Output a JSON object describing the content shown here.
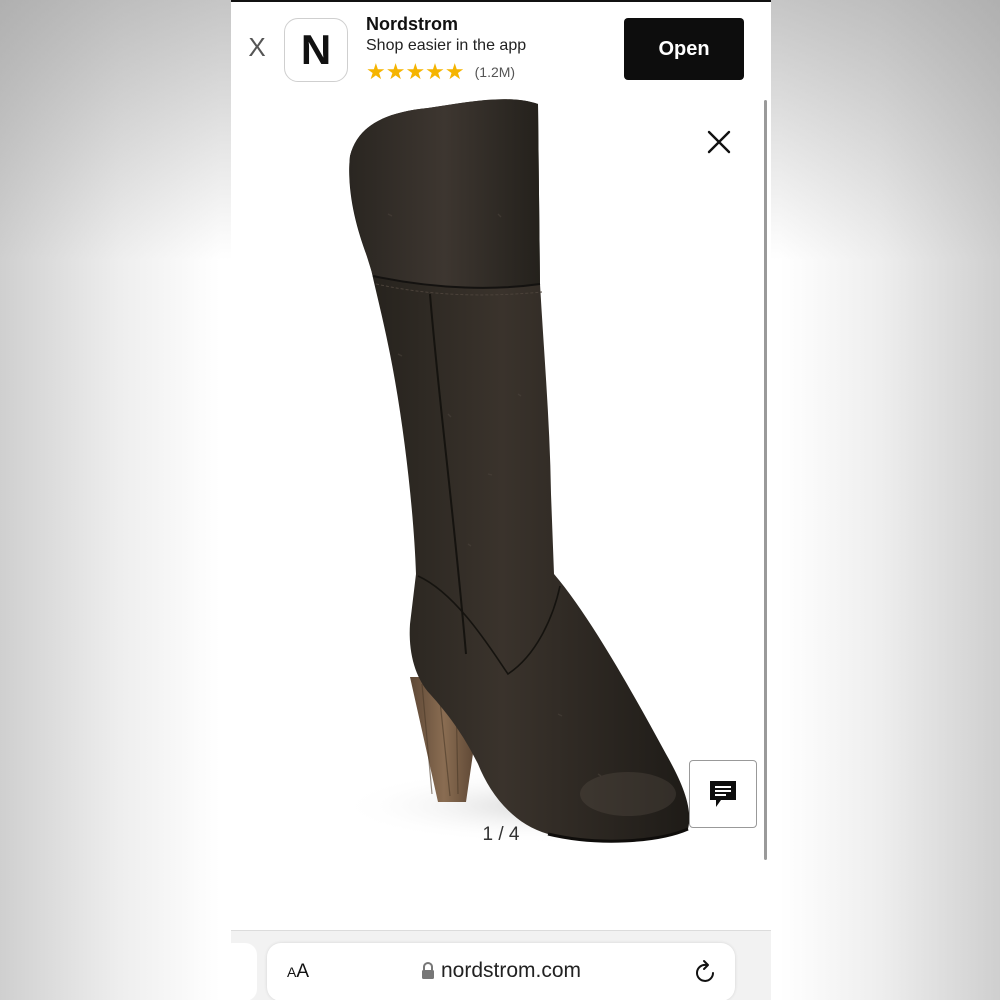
{
  "banner": {
    "close_label": "X",
    "icon_letter": "N",
    "app_name": "Nordstrom",
    "tagline": "Shop easier in the app",
    "stars": "★★★★★",
    "rating_count": "(1.2M)",
    "open_label": "Open"
  },
  "viewer": {
    "counter": "1 / 4",
    "image_index": 1,
    "image_total": 4
  },
  "browser": {
    "text_size_small": "A",
    "text_size_large": "A",
    "url": "nordstrom.com"
  },
  "colors": {
    "star": "#f5b400",
    "open_button_bg": "#0d0d0d",
    "boot_leather": "#2e2822",
    "heel_wood": "#7a6048"
  },
  "icons": [
    "close-icon",
    "chat-icon",
    "lock-icon",
    "reload-icon",
    "star-icon"
  ]
}
